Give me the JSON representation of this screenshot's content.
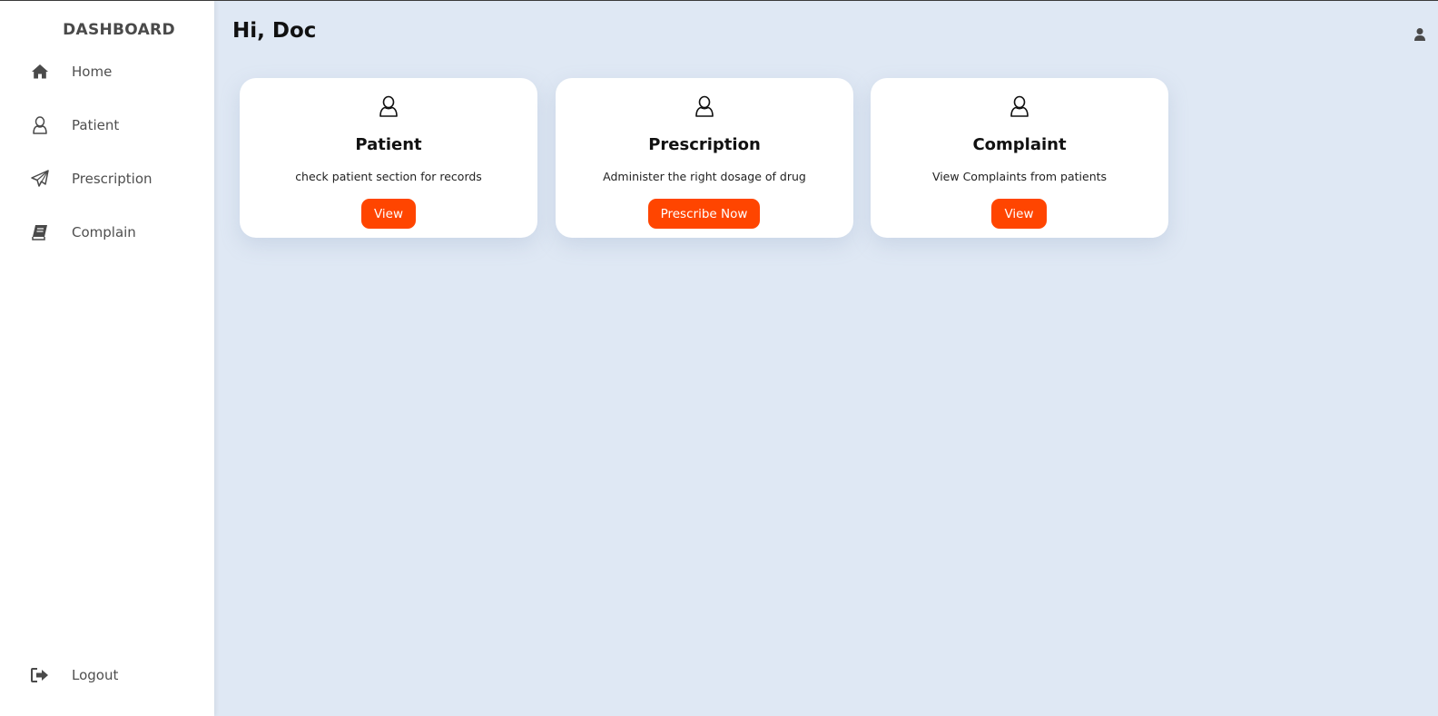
{
  "sidebar": {
    "brand": "DASHBOARD",
    "items": [
      {
        "label": "Home",
        "icon": "home-icon"
      },
      {
        "label": "Patient",
        "icon": "user-outline-icon"
      },
      {
        "label": "Prescription",
        "icon": "paper-plane-icon"
      },
      {
        "label": "Complain",
        "icon": "book-icon"
      }
    ],
    "logout": {
      "label": "Logout",
      "icon": "sign-out-icon"
    }
  },
  "header": {
    "greeting": "Hi, Doc",
    "user_icon": "user-icon"
  },
  "cards": [
    {
      "title": "Patient",
      "description": "check patient section for records",
      "button": "View",
      "icon": "user-outline-icon"
    },
    {
      "title": "Prescription",
      "description": "Administer the right dosage of drug",
      "button": "Prescribe Now",
      "icon": "user-outline-icon"
    },
    {
      "title": "Complaint",
      "description": "View Complaints from patients",
      "button": "View",
      "icon": "user-outline-icon"
    }
  ],
  "colors": {
    "accent": "#ff4500",
    "main_background": "#dfe8f4",
    "sidebar_background": "#ffffff"
  }
}
